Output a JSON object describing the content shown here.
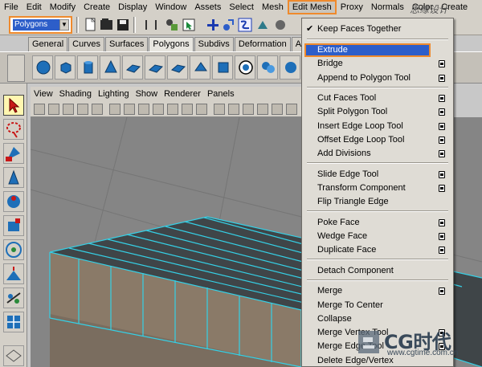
{
  "menubar": {
    "items": [
      "File",
      "Edit",
      "Modify",
      "Create",
      "Display",
      "Window",
      "Assets",
      "Select",
      "Mesh",
      "Edit Mesh",
      "Proxy",
      "Normals",
      "Color",
      "Create"
    ],
    "active": "Edit Mesh"
  },
  "statusline": {
    "mode_value": "Polygons"
  },
  "shelf": {
    "tabs": [
      "General",
      "Curves",
      "Surfaces",
      "Polygons",
      "Subdivs",
      "Deformation",
      "Animation"
    ],
    "active_tab": "Polygons"
  },
  "panel": {
    "menus": [
      "View",
      "Shading",
      "Lighting",
      "Show",
      "Renderer",
      "Panels"
    ]
  },
  "dropdown": {
    "items": [
      {
        "label": "Keep Faces Together",
        "checked": true,
        "option_box": false
      },
      {
        "label": "Extrude",
        "highlighted": true,
        "option_box": true
      },
      {
        "label": "Bridge",
        "option_box": true
      },
      {
        "label": "Append to Polygon Tool",
        "option_box": true
      },
      {
        "label": "Cut Faces Tool",
        "option_box": true
      },
      {
        "label": "Split Polygon Tool",
        "option_box": true
      },
      {
        "label": "Insert Edge Loop Tool",
        "option_box": true
      },
      {
        "label": "Offset Edge Loop Tool",
        "option_box": true
      },
      {
        "label": "Add Divisions",
        "option_box": true
      },
      {
        "label": "Slide Edge Tool",
        "option_box": true
      },
      {
        "label": "Transform Component",
        "option_box": true
      },
      {
        "label": "Flip Triangle Edge",
        "option_box": false
      },
      {
        "label": "Poke Face",
        "option_box": true
      },
      {
        "label": "Wedge Face",
        "option_box": true
      },
      {
        "label": "Duplicate Face",
        "option_box": true
      },
      {
        "label": "Detach Component",
        "option_box": false
      },
      {
        "label": "Merge",
        "option_box": true
      },
      {
        "label": "Merge To Center",
        "option_box": false
      },
      {
        "label": "Collapse",
        "option_box": false
      },
      {
        "label": "Merge Vertex Tool",
        "option_box": true
      },
      {
        "label": "Merge Edge Tool",
        "option_box": true
      },
      {
        "label": "Delete Edge/Vertex",
        "option_box": false
      }
    ]
  },
  "watermark": {
    "brand": "CG时代",
    "url": "www.cgtime.com.cn",
    "top_text": "思缘设计"
  },
  "colors": {
    "accent": "#ef8a2c",
    "highlight": "#2d5ec9",
    "mesh_edge": "#35d0e6",
    "viewport": "#858585"
  }
}
